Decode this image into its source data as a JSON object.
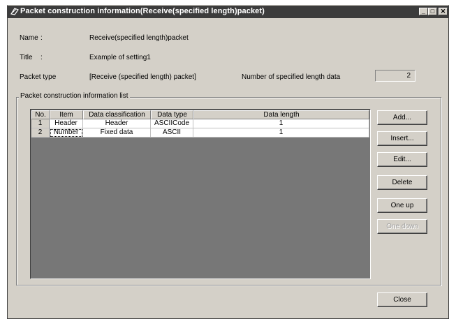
{
  "window": {
    "title": "Packet construction information(Receive(specified length)packet)",
    "minimize_glyph": "_",
    "maximize_glyph": "□",
    "close_glyph": "✕"
  },
  "info": {
    "name_label": "Name",
    "name_sep": ":",
    "name_value": "Receive(specified length)packet",
    "title_label": "Title",
    "title_sep": ":",
    "title_value": "Example of setting1",
    "packet_type_label": "Packet type",
    "packet_type_value": "[Receive (specified length) packet]",
    "num_data_label": "Number of specified length data",
    "num_data_value": "2"
  },
  "group": {
    "label": "Packet construction information list"
  },
  "table": {
    "headers": [
      "No.",
      "Item",
      "Data classification",
      "Data type",
      "Data length"
    ],
    "rows": [
      [
        "1",
        "Header",
        "Header",
        "ASCIICode",
        "1"
      ],
      [
        "2",
        "Number",
        "Fixed data",
        "ASCII",
        "1"
      ]
    ]
  },
  "buttons": {
    "add": "Add...",
    "insert": "Insert...",
    "edit": "Edit...",
    "delete": "Delete",
    "one_up": "One up",
    "one_down": "One down",
    "close": "Close"
  },
  "icons": {
    "title_icon": "packet-icon"
  }
}
